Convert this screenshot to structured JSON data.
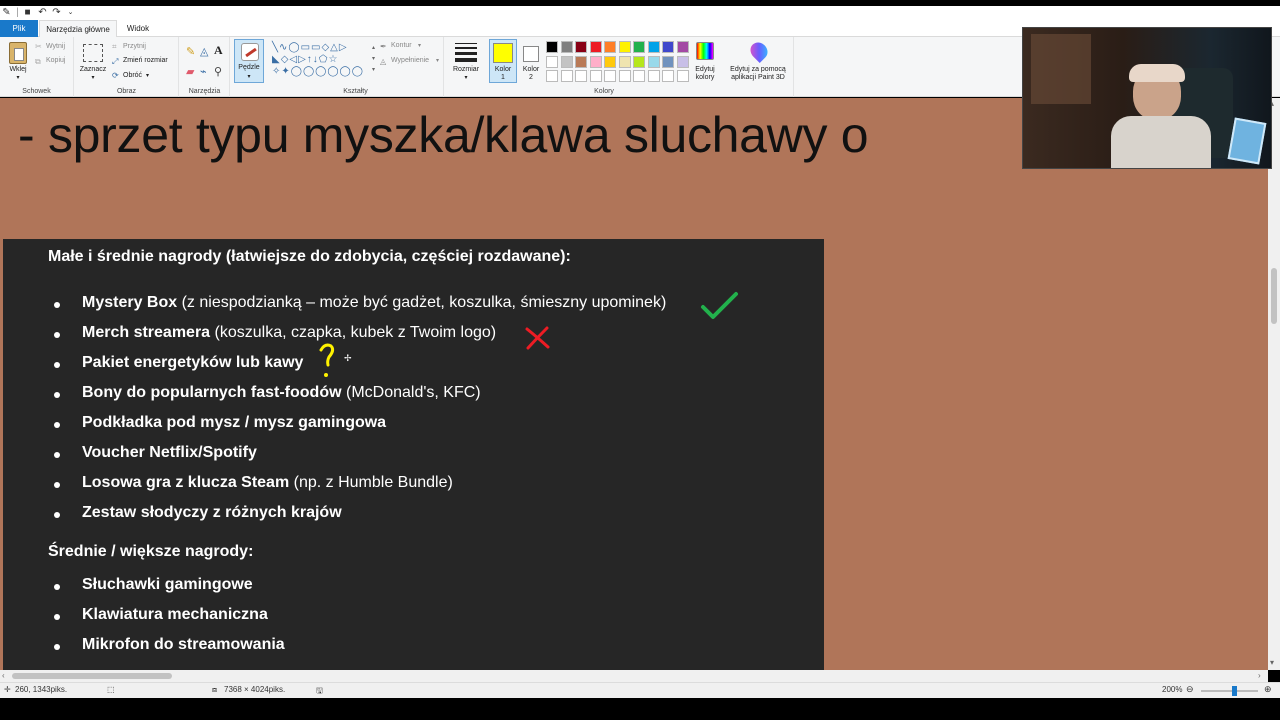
{
  "titlebar": {
    "separator": "|"
  },
  "tabs": {
    "file": "Plik",
    "home": "Narzędzia główne",
    "view": "Widok"
  },
  "ribbon": {
    "clipboard": {
      "paste": "Wklej",
      "cut": "Wytnij",
      "copy": "Kopiuj",
      "group": "Schowek"
    },
    "image": {
      "select": "Zaznacz",
      "crop": "Przytnij",
      "resize": "Zmień rozmiar",
      "rotate": "Obróć",
      "group": "Obraz"
    },
    "tools": {
      "group": "Narzędzia"
    },
    "brushes": {
      "label": "Pędzle"
    },
    "shapes": {
      "outline": "Kontur",
      "fill": "Wypełnienie",
      "group": "Kształty"
    },
    "size": {
      "label": "Rozmiar"
    },
    "color1": {
      "line1": "Kolor",
      "line2": "1"
    },
    "color2": {
      "line1": "Kolor",
      "line2": "2"
    },
    "colors": {
      "group": "Kolory",
      "edit_line1": "Edytuj",
      "edit_line2": "kolory",
      "row1": [
        "#000000",
        "#7f7f7f",
        "#880015",
        "#ed1c24",
        "#ff7f27",
        "#fff200",
        "#22b14c",
        "#00a2e8",
        "#3f48cc",
        "#a349a4"
      ],
      "row2": [
        "#ffffff",
        "#c3c3c3",
        "#b97a57",
        "#ffaec9",
        "#ffc90e",
        "#efe4b0",
        "#b5e61d",
        "#99d9ea",
        "#7092be",
        "#c8bfe7"
      ],
      "color1_value": "#ffff00",
      "color2_value": "#ffffff"
    },
    "paint3d": {
      "line1": "Edytuj za pomocą",
      "line2": "aplikacji Paint 3D"
    }
  },
  "canvas": {
    "title": "- sprzet typu myszka/klawa sluchawy o",
    "heading1": "Małe i średnie nagrody (łatwiejsze do zdobycia, częściej rozdawane):",
    "items1": [
      {
        "bold": "Mystery Box",
        "rest": " (z niespodzianką – może być gadżet, koszulka, śmieszny upominek)"
      },
      {
        "bold": "Merch streamera",
        "rest": " (koszulka, czapka, kubek z Twoim logo)"
      },
      {
        "bold": "Pakiet energetyków lub kawy",
        "rest": ""
      },
      {
        "bold": "Bony do popularnych fast-foodów",
        "rest": " (McDonald's, KFC)"
      },
      {
        "bold": "Podkładka pod mysz / mysz gamingowa",
        "rest": ""
      },
      {
        "bold": "Voucher Netflix/Spotify",
        "rest": ""
      },
      {
        "bold": "Losowa gra z klucza Steam",
        "rest": " (np. z Humble Bundle)"
      },
      {
        "bold": "Zestaw słodyczy z różnych krajów",
        "rest": ""
      }
    ],
    "heading2": "Średnie / większe nagrody:",
    "items2": [
      {
        "bold": "Słuchawki gamingowe",
        "rest": ""
      },
      {
        "bold": "Klawiatura mechaniczna",
        "rest": ""
      },
      {
        "bold": "Mikrofon do streamowania",
        "rest": ""
      }
    ],
    "annotation_colors": {
      "check": "#22b14c",
      "cross": "#ed1c24",
      "question": "#fff200"
    }
  },
  "status": {
    "position": "260, 1343piks.",
    "image_size": "7368 × 4024piks.",
    "zoom": "200%"
  }
}
